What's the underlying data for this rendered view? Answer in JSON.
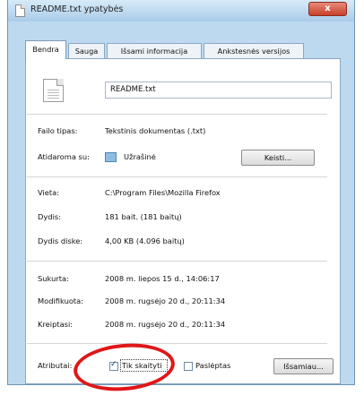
{
  "window": {
    "title": "README.txt ypatybės",
    "close_label": "x"
  },
  "tabs": [
    {
      "label": "Bendra",
      "active": true
    },
    {
      "label": "Sauga",
      "active": false
    },
    {
      "label": "Išsami informacija",
      "active": false
    },
    {
      "label": "Ankstesnės versijos",
      "active": false
    }
  ],
  "file": {
    "name": "README.txt",
    "icon": "text-file-icon"
  },
  "properties": {
    "type_label": "Failo tipas:",
    "type_value": "Tekstinis dokumentas (.txt)",
    "opens_label": "Atidaroma su:",
    "opens_value": "Užrašinė",
    "opens_icon": "notepad-icon",
    "change_button": "Keisti...",
    "location_label": "Vieta:",
    "location_value": "C:\\Program Files\\Mozilla Firefox",
    "size_label": "Dydis:",
    "size_value": "181 bait. (181 baitų)",
    "size_on_disk_label": "Dydis diske:",
    "size_on_disk_value": "4,00 KB (4.096 baitų)",
    "created_label": "Sukurta:",
    "created_value": "2008 m. liepos 15 d., 14:06:17",
    "modified_label": "Modifikuota:",
    "modified_value": "2008 m. rugsėjo 20 d., 20:11:34",
    "accessed_label": "Kreiptasi:",
    "accessed_value": "2008 m. rugsėjo 20 d., 20:11:34"
  },
  "attributes": {
    "label": "Atributai:",
    "readonly_label": "Tik skaityti",
    "readonly_checked": true,
    "hidden_label": "Paslėptas",
    "hidden_checked": false,
    "advanced_button": "Išsamiau..."
  },
  "colors": {
    "annotation": "#e01618"
  }
}
